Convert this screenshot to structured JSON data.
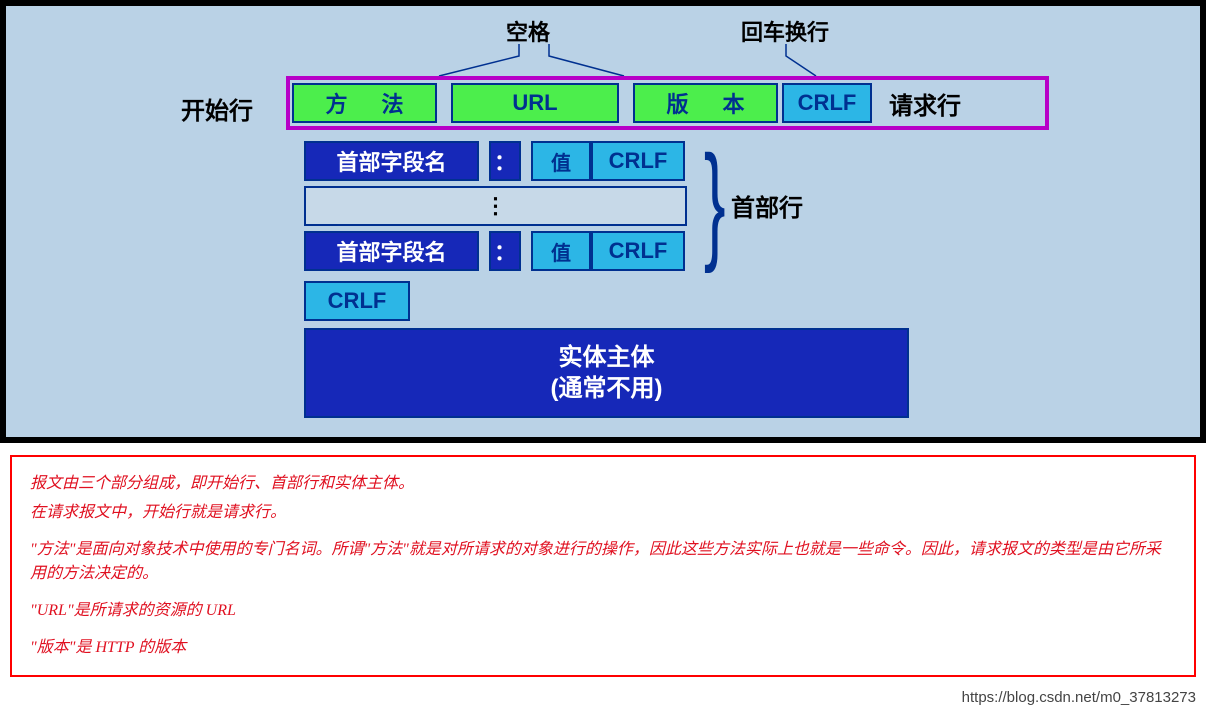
{
  "labels": {
    "space": "空格",
    "crlf_top": "回车换行",
    "start_line": "开始行",
    "request_line": "请求行",
    "header_line": "首部行"
  },
  "request_row": {
    "method": "方   法",
    "url": "URL",
    "version": "版   本",
    "crlf": "CRLF"
  },
  "header": {
    "field_name": "首部字段名",
    "colon": "：",
    "value": "值",
    "crlf": "CRLF",
    "ellipsis": "⋮"
  },
  "crlf_alone": "CRLF",
  "body": {
    "line1": "实体主体",
    "line2": "(通常不用)"
  },
  "notes": {
    "p1": "报文由三个部分组成，即开始行、首部行和实体主体。",
    "p2": "在请求报文中，开始行就是请求行。",
    "p3": "\"方法\"是面向对象技术中使用的专门名词。所谓\"方法\"就是对所请求的对象进行的操作，因此这些方法实际上也就是一些命令。因此，请求报文的类型是由它所采用的方法决定的。",
    "p4": "\"URL\"是所请求的资源的 URL",
    "p5": "\"版本\"是 HTTP 的版本"
  },
  "watermark": "https://blog.csdn.net/m0_37813273"
}
